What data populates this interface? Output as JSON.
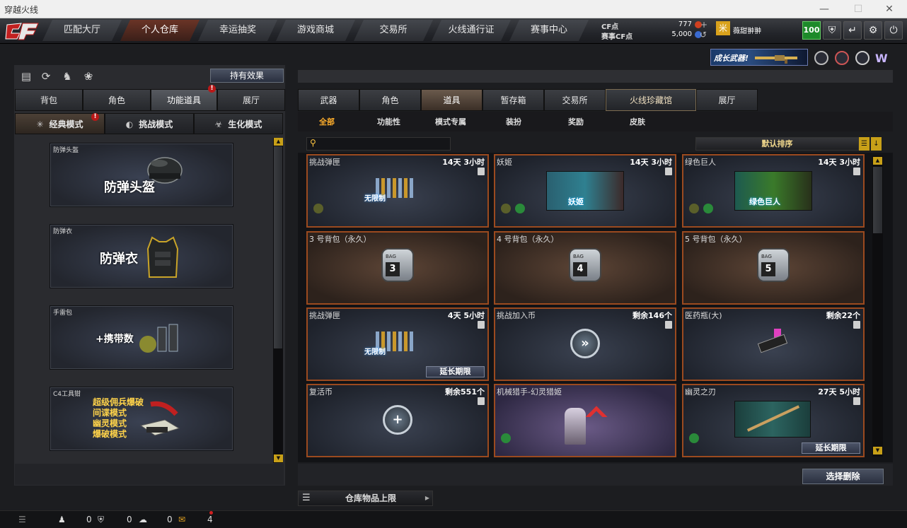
{
  "window": {
    "title": "穿越火线"
  },
  "nav": {
    "tabs": [
      {
        "label": "匹配大厅",
        "active": false,
        "dot": false
      },
      {
        "label": "个人仓库",
        "active": true,
        "dot": false
      },
      {
        "label": "幸运抽奖",
        "active": false,
        "dot": false
      },
      {
        "label": "游戏商城",
        "active": false,
        "dot": true
      },
      {
        "label": "交易所",
        "active": false,
        "dot": false
      },
      {
        "label": "火线通行证",
        "active": false,
        "dot": false
      },
      {
        "label": "赛事中心",
        "active": false,
        "dot": true
      }
    ],
    "cf_label": "CF点",
    "cf_value": "777",
    "event_cf_label": "赛事CF点",
    "event_cf_value": "5,000",
    "player_name": "薇甜翀翀",
    "level": "100",
    "banner": "成长武器!"
  },
  "left": {
    "effect_button": "持有效果",
    "tabs": [
      {
        "label": "背包"
      },
      {
        "label": "角色"
      },
      {
        "label": "功能道具",
        "badge": "!"
      },
      {
        "label": "展厅"
      }
    ],
    "modes": [
      {
        "label": "经典模式",
        "badge": "!"
      },
      {
        "label": "挑战模式"
      },
      {
        "label": "生化模式"
      }
    ],
    "cards": [
      {
        "label": "防弹头盔",
        "big": "防弹头盔"
      },
      {
        "label": "防弹衣",
        "big": "防弹衣"
      },
      {
        "label": "手雷包",
        "big": "+携带数"
      },
      {
        "label": "C4工具钳",
        "lines": [
          "超级佣兵爆破",
          "间谍模式",
          "幽灵模式",
          "爆破模式"
        ]
      }
    ]
  },
  "right": {
    "tabs": [
      {
        "label": "武器"
      },
      {
        "label": "角色"
      },
      {
        "label": "道具"
      },
      {
        "label": "暂存箱"
      },
      {
        "label": "交易所"
      },
      {
        "label": "火线珍藏馆"
      },
      {
        "label": "展厅"
      }
    ],
    "subtabs": [
      "全部",
      "功能性",
      "模式专属",
      "装扮",
      "奖励",
      "皮肤"
    ],
    "sort_label": "默认排序",
    "items": [
      {
        "name": "挑战弹匣",
        "time": "14天 3小时",
        "art": "无限制"
      },
      {
        "name": "妖姬",
        "time": "14天 3小时",
        "art": "妖姬"
      },
      {
        "name": "绿色巨人",
        "time": "14天 3小时",
        "art": "绿色巨人"
      },
      {
        "name": "3 号背包（永久）",
        "time": "",
        "art": "3"
      },
      {
        "name": "4 号背包（永久）",
        "time": "",
        "art": "4"
      },
      {
        "name": "5 号背包（永久）",
        "time": "",
        "art": "5"
      },
      {
        "name": "挑战弹匣",
        "time": "4天 5小时",
        "art": "无限制",
        "extend": "延长期限"
      },
      {
        "name": "挑战加入币",
        "time": "剩余146个"
      },
      {
        "name": "医药瓶(大)",
        "time": "剩余22个"
      },
      {
        "name": "复活币",
        "time": "剩余551个"
      },
      {
        "name": "机械猎手-幻灵猎姬",
        "time": ""
      },
      {
        "name": "幽灵之刃",
        "time": "27天 5小时",
        "extend": "延长期限"
      }
    ],
    "delete_button": "选择删除",
    "warehouse_limit": "仓库物品上限",
    "bag_tag": "BAG"
  },
  "status": {
    "count1": "0",
    "count2": "0",
    "count3": "0",
    "count4": "4"
  },
  "colors": {
    "accent": "#ffae2b",
    "card_border": "#9b4a1f",
    "badge_red": "#b91818"
  }
}
